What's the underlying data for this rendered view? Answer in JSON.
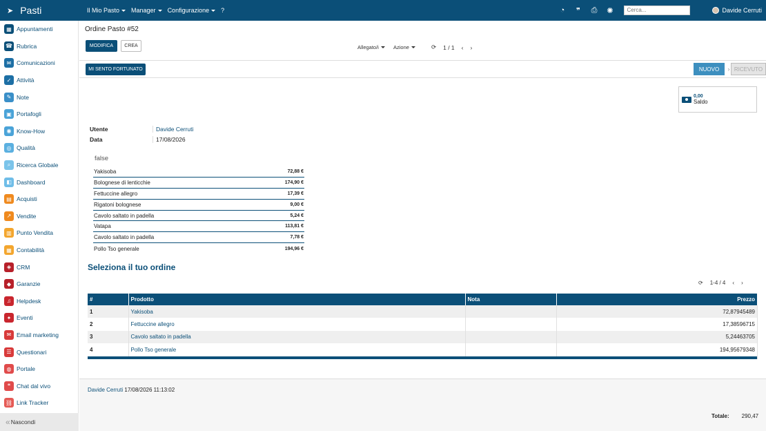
{
  "topbar": {
    "brand": "Pasti",
    "menus": [
      "Il Mio Pasto",
      "Manager",
      "Configurazione"
    ],
    "help": "?",
    "search_placeholder": "Cerca...",
    "user": "Davide Cerruti"
  },
  "sidebar": {
    "items": [
      {
        "label": "Appuntamenti",
        "color": "#0b4f78",
        "icon": "calendar-icon",
        "glyph": "▦"
      },
      {
        "label": "Rubrica",
        "color": "#0b4f78",
        "icon": "contacts-icon",
        "glyph": "☎"
      },
      {
        "label": "Comunicazioni",
        "color": "#1d6fa5",
        "icon": "chat-icon",
        "glyph": "✉"
      },
      {
        "label": "Attività",
        "color": "#1d6fa5",
        "icon": "check-icon",
        "glyph": "✓"
      },
      {
        "label": "Note",
        "color": "#3a8fc8",
        "icon": "note-icon",
        "glyph": "✎"
      },
      {
        "label": "Portafogli",
        "color": "#4aa3d8",
        "icon": "lock-icon",
        "glyph": "▣"
      },
      {
        "label": "Know-How",
        "color": "#4aa3d8",
        "icon": "know-how-icon",
        "glyph": "◉"
      },
      {
        "label": "Qualità",
        "color": "#5bb0e0",
        "icon": "quality-icon",
        "glyph": "◎"
      },
      {
        "label": "Ricerca Globale",
        "color": "#7bc4ea",
        "icon": "search-icon",
        "glyph": "⌕"
      },
      {
        "label": "Dashboard",
        "color": "#6fbde8",
        "icon": "dashboard-icon",
        "glyph": "◧"
      },
      {
        "label": "Acquisti",
        "color": "#ef8a1f",
        "icon": "purchase-icon",
        "glyph": "▤"
      },
      {
        "label": "Vendite",
        "color": "#ef8a1f",
        "icon": "sales-icon",
        "glyph": "↗"
      },
      {
        "label": "Punto Vendita",
        "color": "#f3a62e",
        "icon": "shop-icon",
        "glyph": "▥"
      },
      {
        "label": "Contabilità",
        "color": "#f3a62e",
        "icon": "accounting-icon",
        "glyph": "▦"
      },
      {
        "label": "CRM",
        "color": "#b7202a",
        "icon": "crm-icon",
        "glyph": "◈"
      },
      {
        "label": "Garanzie",
        "color": "#b7202a",
        "icon": "shield-icon",
        "glyph": "◆"
      },
      {
        "label": "Helpdesk",
        "color": "#c9262e",
        "icon": "headset-icon",
        "glyph": "♫"
      },
      {
        "label": "Eventi",
        "color": "#c9262e",
        "icon": "events-icon",
        "glyph": "✦"
      },
      {
        "label": "Email marketing",
        "color": "#d83a3a",
        "icon": "email-icon",
        "glyph": "✉"
      },
      {
        "label": "Questionari",
        "color": "#d83a3a",
        "icon": "survey-icon",
        "glyph": "☰"
      },
      {
        "label": "Portale",
        "color": "#e04b4b",
        "icon": "portal-icon",
        "glyph": "◍"
      },
      {
        "label": "Chat dal vivo",
        "color": "#e04b4b",
        "icon": "livechat-icon",
        "glyph": "❝"
      },
      {
        "label": "Link Tracker",
        "color": "#e55a55",
        "icon": "link-icon",
        "glyph": "⛓"
      }
    ],
    "hide_label": "Nascondi"
  },
  "control": {
    "breadcrumb": "Ordine Pasto #52",
    "edit_label": "MODIFICA",
    "create_label": "CREA",
    "attachments_label": "Allegato/i",
    "action_label": "Azione",
    "pager": "1 / 1"
  },
  "form": {
    "lucky_label": "MI SENTO FORTUNATO",
    "stages": [
      "NUOVO",
      "RICEVUTO"
    ],
    "saldo_value": "0,00",
    "saldo_label": "Saldo",
    "user_label": "Utente",
    "user_value": "Davide Cerruti",
    "date_label": "Data",
    "date_value": "17/08/2026",
    "list_title": "false",
    "list": [
      {
        "name": "Yakisoba",
        "price": "72,88 €"
      },
      {
        "name": "Bolognese di lenticchie",
        "price": "174,90 €"
      },
      {
        "name": "Fettuccine allegro",
        "price": "17,39 €"
      },
      {
        "name": "Rigatoni bolognese",
        "price": "9,00 €"
      },
      {
        "name": "Cavolo saltato in padella",
        "price": "5,24 €"
      },
      {
        "name": "Vatapa",
        "price": "113,81 €"
      },
      {
        "name": "Cavolo saltato in padella",
        "price": "7,78 €"
      },
      {
        "name": "Pollo Tso generale",
        "price": "194,96 €"
      }
    ],
    "section_title": "Seleziona il tuo ordine",
    "table_pager": "1-4 / 4",
    "table": {
      "headers": [
        "#",
        "Prodotto",
        "Nota",
        "Prezzo"
      ],
      "rows": [
        {
          "n": "1",
          "product": "Yakisoba",
          "note": "",
          "price": "72,87945489"
        },
        {
          "n": "2",
          "product": "Fettuccine allegro",
          "note": "",
          "price": "17,38596715"
        },
        {
          "n": "3",
          "product": "Cavolo saltato in padella",
          "note": "",
          "price": "5,24463705"
        },
        {
          "n": "4",
          "product": "Pollo Tso generale",
          "note": "",
          "price": "194,95679348"
        }
      ]
    },
    "footer_user": "Davide Cerruti",
    "footer_time": "17/08/2026 11:13:02",
    "total_label": "Totale:",
    "total_value": "290,47"
  }
}
